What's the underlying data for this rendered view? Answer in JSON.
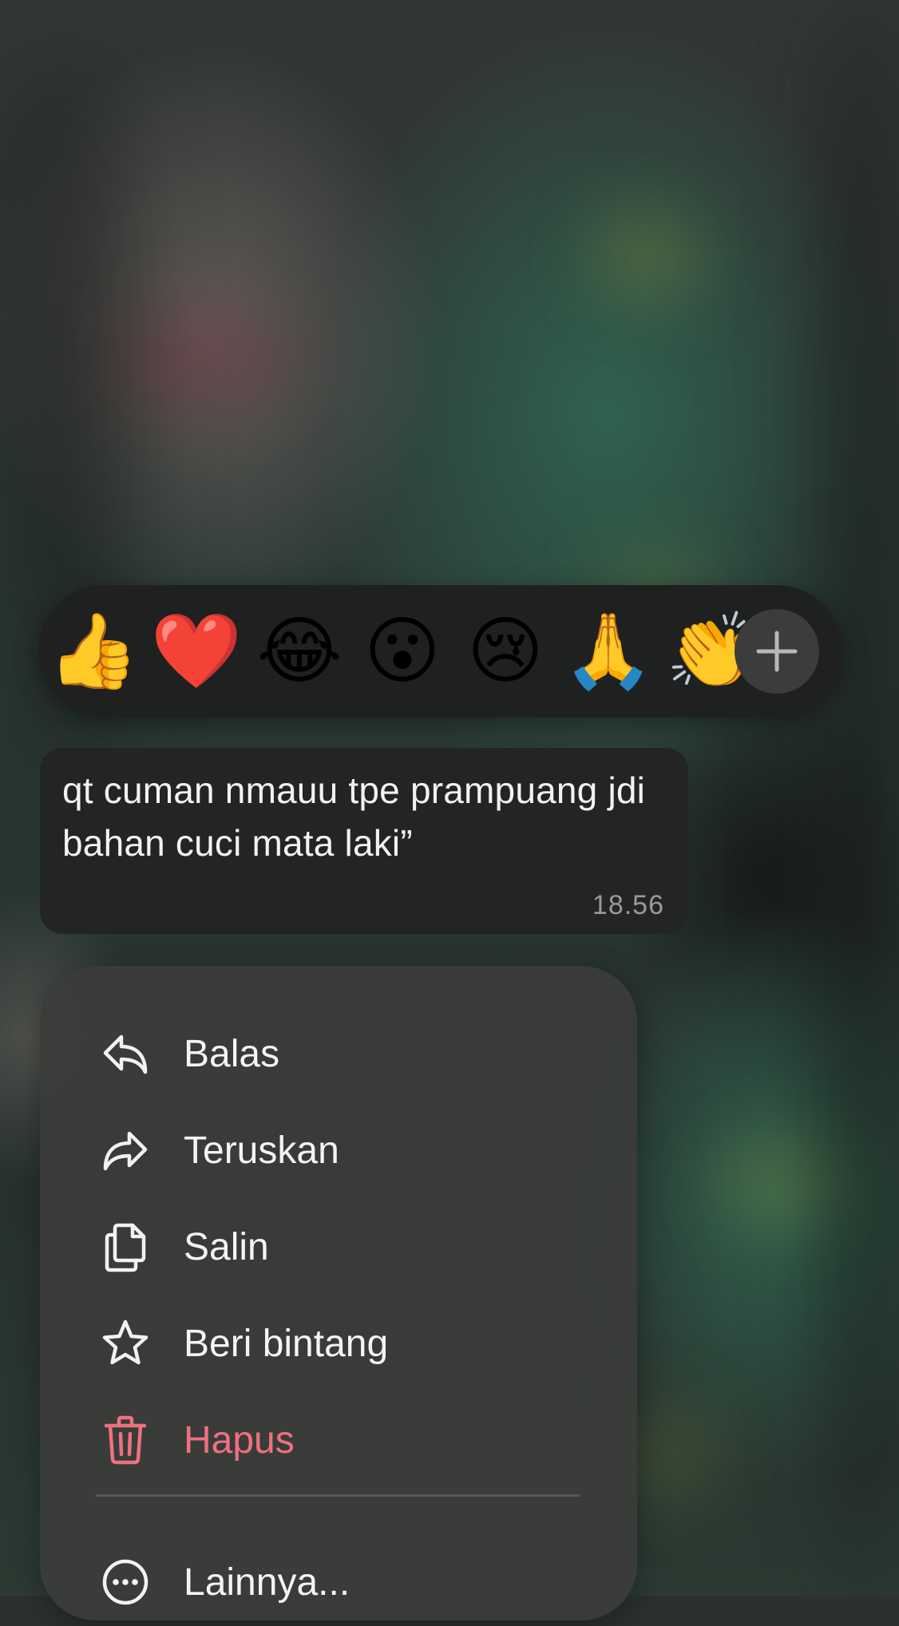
{
  "reactions": {
    "emojis": [
      {
        "name": "thumbs-up",
        "glyph": "👍"
      },
      {
        "name": "red-heart",
        "glyph": "❤️"
      },
      {
        "name": "tears-of-joy",
        "glyph": "😂"
      },
      {
        "name": "surprised",
        "glyph": "😮"
      },
      {
        "name": "crying",
        "glyph": "😢"
      },
      {
        "name": "folded-hands",
        "glyph": "🙏"
      },
      {
        "name": "clapping-hands",
        "glyph": "👏"
      }
    ],
    "more_icon": "plus-icon"
  },
  "message": {
    "text": "qt cuman nmauu tpe prampuang jdi bahan cuci mata laki”",
    "time": "18.56"
  },
  "menu": {
    "items": [
      {
        "label": "Balas",
        "icon": "reply-icon"
      },
      {
        "label": "Teruskan",
        "icon": "forward-icon"
      },
      {
        "label": "Salin",
        "icon": "copy-icon"
      },
      {
        "label": "Beri bintang",
        "icon": "star-icon"
      },
      {
        "label": "Hapus",
        "icon": "trash-icon",
        "color": "#f0707f"
      },
      {
        "label": "Lainnya...",
        "icon": "more-icon"
      }
    ]
  },
  "colors": {
    "menu_background": "#3a3c3a",
    "bubble_background": "#232424",
    "danger": "#f0707f"
  }
}
